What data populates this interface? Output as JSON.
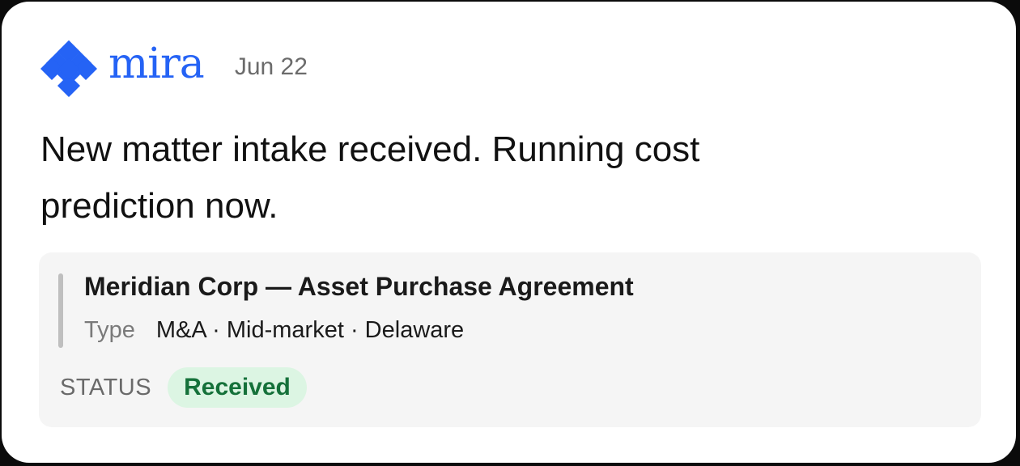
{
  "brand": {
    "name": "mira",
    "icon": "diamond-logo-icon",
    "color": "#2563f5"
  },
  "header": {
    "date": "Jun 22"
  },
  "message": {
    "text": "New matter intake received. Running cost prediction now."
  },
  "matter": {
    "title": "Meridian Corp — Asset Purchase Agreement",
    "type_label": "Type",
    "type_value": "M&A · Mid-market · Delaware",
    "status_label": "STATUS",
    "status_value": "Received",
    "status_color": "#15713a",
    "status_bg": "#dcf5e3"
  }
}
